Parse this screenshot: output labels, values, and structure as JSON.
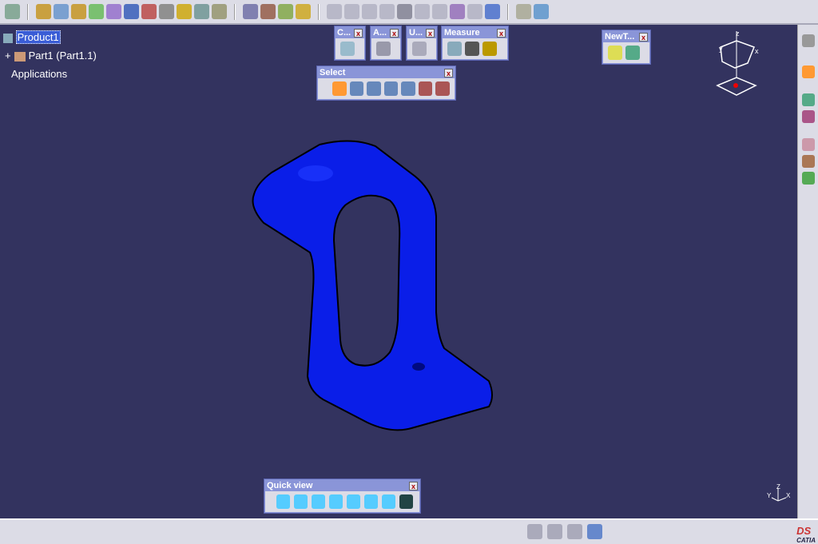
{
  "toolbar": {
    "icon_count": 38
  },
  "tree": {
    "root": "Product1",
    "child": "Part1 (Part1.1)",
    "applications": "Applications"
  },
  "palettes": {
    "c": "C...",
    "a": "A...",
    "u": "U...",
    "measure": "Measure",
    "newt": "NewT...",
    "select": "Select",
    "quickview": "Quick view",
    "close": "x"
  },
  "compass": {
    "z": "z",
    "x": "x",
    "y": "y"
  },
  "axis": {
    "x": "X",
    "y": "Y",
    "z": "Z"
  },
  "logo": {
    "text": "CATIA"
  },
  "colors": {
    "viewport": "#33335f",
    "part": "#0a1ee8",
    "toolbar": "#dcdce6"
  }
}
